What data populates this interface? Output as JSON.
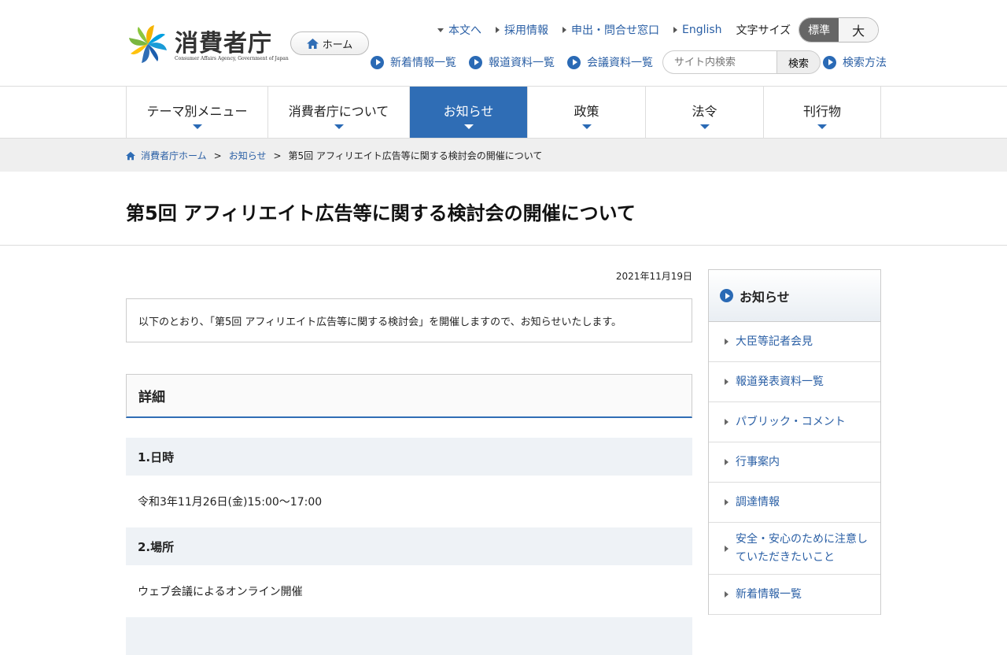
{
  "header": {
    "logo_text": "消費者庁",
    "logo_subtitle": "Consumer Affairs Agency, Government of Japan",
    "home_label": "ホーム",
    "util_links": [
      {
        "label": "本文へ",
        "marker": "down"
      },
      {
        "label": "採用情報",
        "marker": "right"
      },
      {
        "label": "申出・問合せ窓口",
        "marker": "right"
      },
      {
        "label": "English",
        "marker": "right"
      }
    ],
    "font_size_label": "文字サイズ",
    "font_size_standard": "標準",
    "font_size_large": "大",
    "sub_links": [
      "新着情報一覧",
      "報道資料一覧",
      "会議資料一覧"
    ],
    "search_placeholder": "サイト内検索",
    "search_button": "検索",
    "search_help": "検索方法"
  },
  "gnav": {
    "items": [
      {
        "label": "テーマ別メニュー"
      },
      {
        "label": "消費者庁について"
      },
      {
        "label": "お知らせ"
      },
      {
        "label": "政策"
      },
      {
        "label": "法令"
      },
      {
        "label": "刊行物"
      }
    ],
    "active_index": 2
  },
  "breadcrumb": {
    "home": "消費者庁ホーム",
    "parent": "お知らせ",
    "current": "第5回 アフィリエイト広告等に関する検討会の開催について",
    "separator": ">"
  },
  "page": {
    "title": "第5回 アフィリエイト広告等に関する検討会の開催について",
    "date": "2021年11月19日",
    "intro": "以下のとおり、「第5回 アフィリエイト広告等に関する検討会」を開催しますので、お知らせいたします。",
    "section_title": "詳細",
    "subsections": [
      {
        "heading": "1.日時",
        "body": "令和3年11月26日(金)15:00～17:00"
      },
      {
        "heading": "2.場所",
        "body": "ウェブ会議によるオンライン開催"
      }
    ]
  },
  "side": {
    "title": "お知らせ",
    "items": [
      "大臣等記者会見",
      "報道発表資料一覧",
      "パブリック・コメント",
      "行事案内",
      "調達情報",
      "安全・安心のために注意していただきたいこと",
      "新着情報一覧"
    ]
  },
  "colors": {
    "accent": "#2f6db5",
    "link": "#2a5fa5",
    "breadcrumb_bg": "#efefef",
    "subheading_bg": "#eef2f6"
  }
}
